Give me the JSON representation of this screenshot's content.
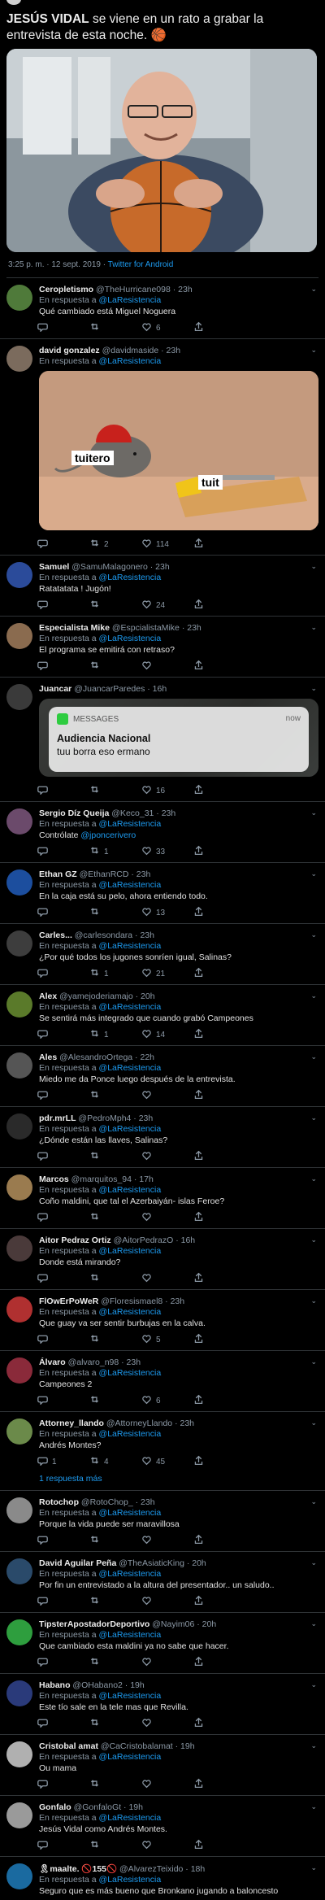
{
  "main": {
    "author": "JESÚS VIDAL",
    "text": "se viene en un rato a grabar la entrevista de esta noche. 🏀",
    "time": "3:25 p. m. · 12 sept. 2019 · ",
    "source": "Twitter for Android",
    "photo_alt": "Man with glasses resting hands on a basketball"
  },
  "in_reply_prefix": "En respuesta a",
  "mention": "@LaResistencia",
  "replies": [
    {
      "name": "Ceropletismo",
      "handle": "@TheHurricane098 · 23h",
      "text": "Qué cambiado está Miguel Noguera",
      "reply": "",
      "rt": "",
      "like": "6",
      "avatar": "#4f7a3a"
    },
    {
      "name": "david gonzalez",
      "handle": "@davidmaside · 23h",
      "text": "",
      "reply": "",
      "rt": "2",
      "like": "114",
      "avatar": "#7b6b5d"
    },
    {
      "name": "Samuel",
      "handle": "@SamuMalagonero · 23h",
      "text": "Ratatatata ! Jugón!",
      "reply": "",
      "rt": "",
      "like": "24",
      "avatar": "#2b4b9a"
    },
    {
      "name": "Especialista Mike",
      "handle": "@EspcialistaMike · 23h",
      "text": "El programa se emitirá con retraso?",
      "reply": "",
      "rt": "",
      "like": "",
      "avatar": "#8a6b4f"
    },
    {
      "name": "Juancar",
      "handle": "@JuancarParedes · 16h",
      "text": "",
      "reply": "",
      "rt": "",
      "like": "16",
      "avatar": "#3a3a3a",
      "no_reply_line": true
    },
    {
      "name": "Sergio Díz Queija",
      "handle": "@Keco_31 · 23h",
      "text": "Contrólate ",
      "text_mention": "@jponcerivero",
      "reply": "",
      "rt": "1",
      "like": "33",
      "avatar": "#6b4a6b"
    },
    {
      "name": "Ethan GZ",
      "handle": "@EthanRCD · 23h",
      "text": "En la caja está su pelo, ahora entiendo todo.",
      "reply": "",
      "rt": "",
      "like": "13",
      "avatar": "#1c4e9e"
    },
    {
      "name": "Carles...",
      "handle": "@carlesondara · 23h",
      "text": "¿Por qué todos los jugones sonríen igual, Salinas?",
      "reply": "",
      "rt": "1",
      "like": "21",
      "avatar": "#3d3d3d"
    },
    {
      "name": "Alex",
      "handle": "@yamejoderiamajo · 20h",
      "text": "Se sentirá más integrado que cuando grabó Campeones",
      "reply": "",
      "rt": "1",
      "like": "14",
      "avatar": "#5a7a2a"
    },
    {
      "name": "Ales",
      "handle": "@AlesandroOrtega · 22h",
      "text": "Miedo me da Ponce luego después de la entrevista.",
      "reply": "",
      "rt": "",
      "like": "",
      "avatar": "#555555"
    },
    {
      "name": "pdr.mrLL",
      "handle": "@PedroMph4 · 23h",
      "text": "¿Dónde están las llaves, Salinas?",
      "reply": "",
      "rt": "",
      "like": "",
      "avatar": "#2a2a2a"
    },
    {
      "name": "Marcos",
      "handle": "@marquitos_94 · 17h",
      "text": "Coño maldini, que tal el Azerbaiyán- islas Feroe?",
      "reply": "",
      "rt": "",
      "like": "",
      "avatar": "#9a7b4f"
    },
    {
      "name": "Aitor Pedraz Ortiz",
      "handle": "@AitorPedrazO · 16h",
      "text": "Donde está mirando?",
      "reply": "",
      "rt": "",
      "like": "",
      "avatar": "#4a3a3a"
    },
    {
      "name": "FlOwErPoWeR",
      "handle": "@Floresismael8 · 23h",
      "text": "Que guay va ser sentir burbujas en la calva.",
      "reply": "",
      "rt": "",
      "like": "5",
      "avatar": "#b03030"
    },
    {
      "name": "Álvaro",
      "handle": "@alvaro_n98 · 23h",
      "text": "Campeones 2",
      "reply": "",
      "rt": "",
      "like": "6",
      "avatar": "#8a2a3a"
    },
    {
      "name": "Attorney_llando",
      "handle": "@AttorneyLlando · 23h",
      "text": "Andrés Montes?",
      "reply": "1",
      "rt": "4",
      "like": "45",
      "avatar": "#6b8a4a",
      "more": "1 respuesta más"
    },
    {
      "name": "Rotochop",
      "handle": "@RotoChop_ · 23h",
      "text": "Porque la vida puede ser maravillosa",
      "reply": "",
      "rt": "",
      "like": "",
      "avatar": "#8a8a8a"
    },
    {
      "name": "David Aguilar Peña",
      "handle": "@TheAsiaticKing · 20h",
      "text": "Por fin un entrevistado a la altura del presentador.. un saludo..",
      "reply": "",
      "rt": "",
      "like": "",
      "avatar": "#2a4a6a"
    },
    {
      "name": "TipsterApostadorDeportivo",
      "handle": "@Nayim06 · 20h",
      "text": "Que cambiado esta maldini ya no sabe que hacer.",
      "reply": "",
      "rt": "",
      "like": "",
      "avatar": "#2e9e3e"
    },
    {
      "name": "Habano",
      "handle": "@OHabano2 · 19h",
      "text": "Este tío sale en la tele mas que Revilla.",
      "reply": "",
      "rt": "",
      "like": "",
      "avatar": "#2a3a7a"
    },
    {
      "name": "Cristobal amat",
      "handle": "@CaCristobalamat · 19h",
      "text": "Ou mama",
      "reply": "",
      "rt": "",
      "like": "",
      "avatar": "#b0b0b0"
    },
    {
      "name": "Gonfalo",
      "handle": "@GonfaloGt · 19h",
      "text": "Jesús Vidal como Andrés Montes.",
      "reply": "",
      "rt": "",
      "like": "",
      "avatar": "#9a9a9a"
    },
    {
      "name": "🎗maalte. 🚫155🚫",
      "handle": "@AlvarezTeixido · 18h",
      "text": "Seguro que es más bueno que Bronkano jugando a baloncesto",
      "reply": "",
      "rt": "",
      "like": "",
      "avatar": "#1a6aa0"
    }
  ],
  "media_mouse": {
    "label_left": "tuitero",
    "label_right": "tuit"
  },
  "media_messages": {
    "app": "MESSAGES",
    "time": "now",
    "title": "Audiencia Nacional",
    "body": "tuu borra eso ermano"
  }
}
